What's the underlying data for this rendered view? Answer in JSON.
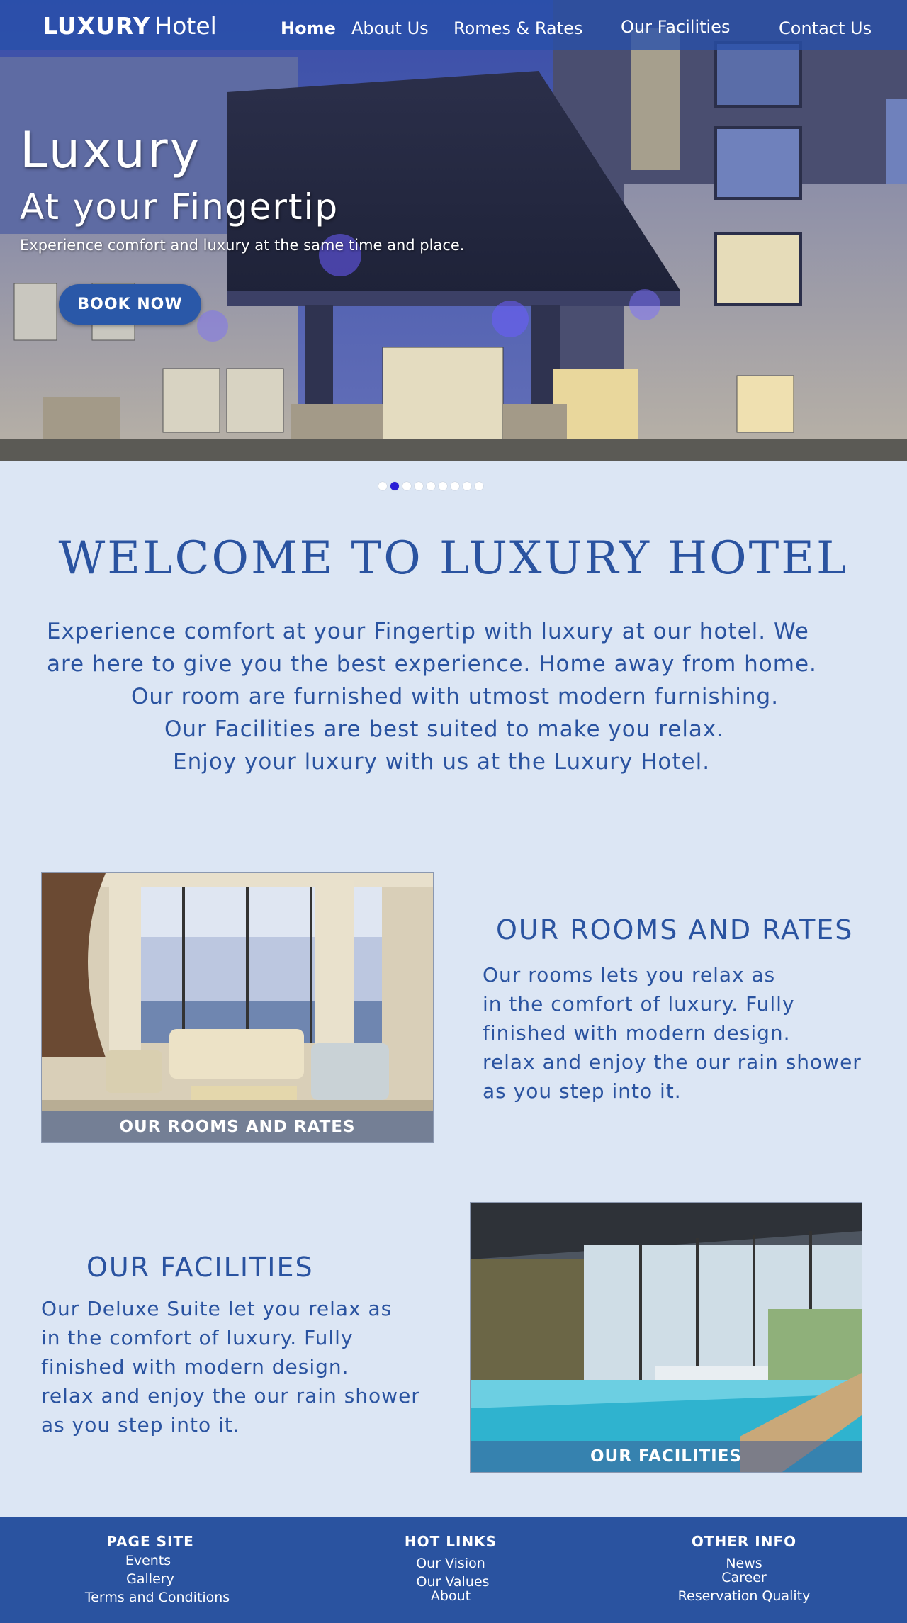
{
  "brand": {
    "strong": "LUXURY",
    "light": "Hotel"
  },
  "nav": {
    "items": [
      {
        "label": "Home",
        "active": true
      },
      {
        "label": "About Us",
        "active": false
      },
      {
        "label": "Romes & Rates",
        "active": false
      },
      {
        "label": "Our Facilities",
        "active": false
      },
      {
        "label": "Contact Us",
        "active": false
      }
    ]
  },
  "hero": {
    "title": "Luxury",
    "subtitle": "At your Fingertip",
    "description": "Experience comfort and luxury at the same time and place.",
    "cta_label": "BOOK NOW"
  },
  "slider": {
    "count": 9,
    "active_index": 1
  },
  "welcome": {
    "title": "WELCOME TO LUXURY HOTEL",
    "lines": [
      "Experience comfort at your Fingertip with luxury at our hotel. We",
      "are here to give you the best experience. Home away from home.",
      "Our room are furnished with utmost modern furnishing.",
      "Our Facilities are best suited to make you relax.",
      "Enjoy your luxury with us at the Luxury Hotel."
    ]
  },
  "rooms": {
    "caption": "OUR ROOMS AND RATES",
    "title": "OUR ROOMS AND RATES",
    "lines": [
      "Our rooms lets you relax as",
      "in the comfort of luxury. Fully",
      "finished with modern design.",
      "relax and enjoy the our rain shower",
      "as you step into it."
    ]
  },
  "facilities": {
    "caption": "OUR FACILITIES",
    "title": "OUR FACILITIES",
    "lines": [
      "Our Deluxe Suite let you relax as",
      "in the comfort of luxury. Fully",
      "finished with modern design.",
      "relax and enjoy the our rain shower",
      "as you step into it."
    ]
  },
  "footer": {
    "columns": [
      {
        "heading": "PAGE SITE",
        "links": [
          "Events",
          "Gallery",
          "Terms and Conditions"
        ]
      },
      {
        "heading": "HOT LINKS",
        "links": [
          "Our Vision",
          "Our Values",
          "About"
        ]
      },
      {
        "heading": "OTHER INFO",
        "links": [
          "News",
          "Career",
          "Reservation Quality"
        ]
      }
    ]
  },
  "colors": {
    "page_background": "#dce6f4",
    "accent_blue": "#2a53a0",
    "active_dot": "#2a1fd6",
    "footer_background": "#2a53a0"
  }
}
